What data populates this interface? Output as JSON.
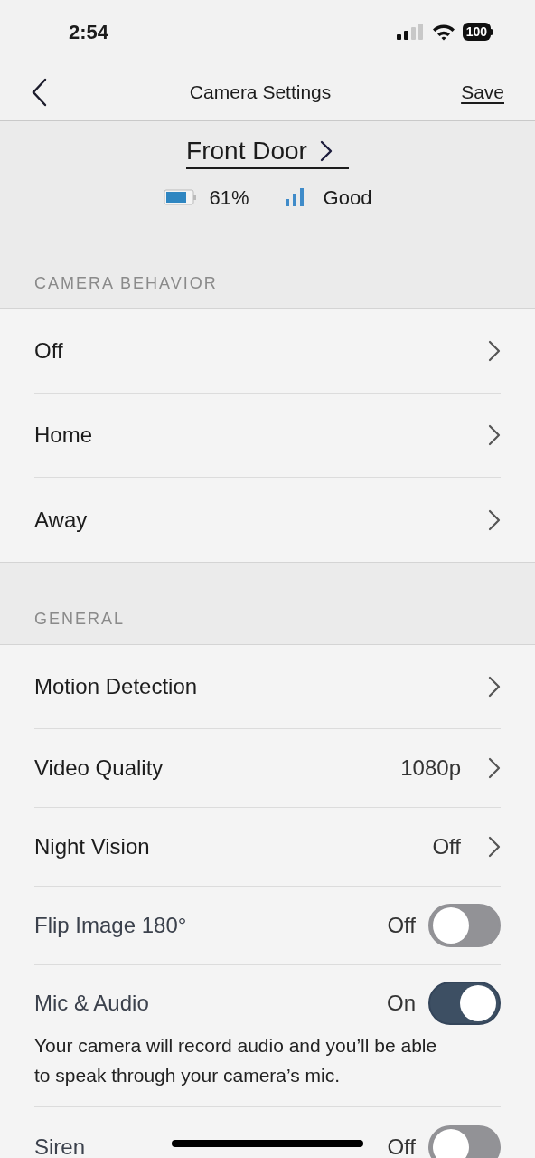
{
  "status_bar": {
    "time": "2:54",
    "battery": "100"
  },
  "nav": {
    "title": "Camera Settings",
    "action": "Save"
  },
  "camera": {
    "name": "Front Door",
    "battery": "61%",
    "signal": "Good"
  },
  "sections": [
    {
      "title": "CAMERA BEHAVIOR",
      "rows": [
        {
          "kind": "link",
          "label": "Off"
        },
        {
          "kind": "link",
          "label": "Home"
        },
        {
          "kind": "link",
          "label": "Away"
        }
      ]
    },
    {
      "title": "GENERAL",
      "rows": [
        {
          "kind": "link",
          "label": "Motion Detection"
        },
        {
          "kind": "link",
          "label": "Video Quality",
          "value": "1080p"
        },
        {
          "kind": "link",
          "label": "Night Vision",
          "value": "Off"
        },
        {
          "kind": "toggle",
          "label": "Flip Image 180°",
          "value": "Off",
          "on": false
        },
        {
          "kind": "toggle",
          "label": "Mic & Audio",
          "value": "On",
          "on": true,
          "description": "Your camera will record audio and you’ll be able to speak through your camera’s mic."
        },
        {
          "kind": "toggle",
          "label": "Siren",
          "value": "Off",
          "on": false
        }
      ]
    }
  ]
}
